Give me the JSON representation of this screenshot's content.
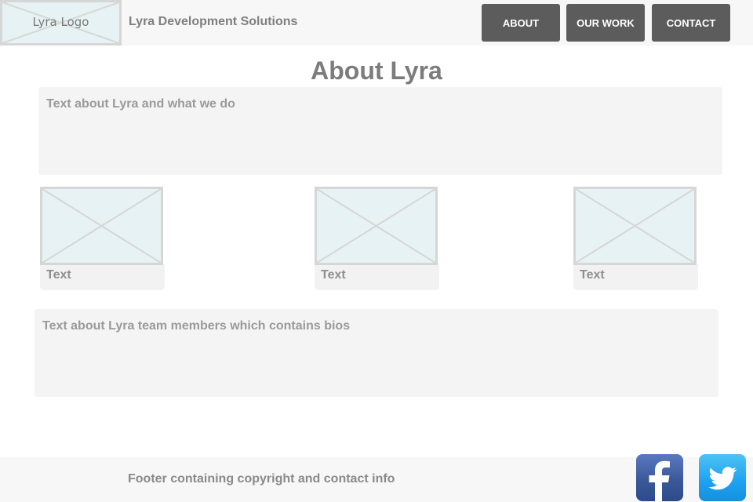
{
  "header": {
    "logo_text": "Lyra Logo",
    "company_name": "Lyra Development Solutions",
    "nav": {
      "about": "ABOUT",
      "our_work": "OUR WORK",
      "contact": "CONTACT"
    }
  },
  "main": {
    "title": "About Lyra",
    "about_text": "Text about Lyra and what we do",
    "cards": [
      {
        "label": "Text"
      },
      {
        "label": "Text"
      },
      {
        "label": "Text"
      }
    ],
    "team_text": "Text about Lyra team members which contains bios"
  },
  "footer": {
    "text": "Footer containing copyright and contact info",
    "social": [
      {
        "icon": "facebook-icon"
      },
      {
        "icon": "twitter-icon"
      }
    ]
  },
  "colors": {
    "nav_button_bg": "#5c5c5c",
    "placeholder_fill": "#e6f2f3",
    "placeholder_border": "#d6d6d6",
    "facebook": "#3b5998",
    "twitter": "#1da1f2"
  }
}
